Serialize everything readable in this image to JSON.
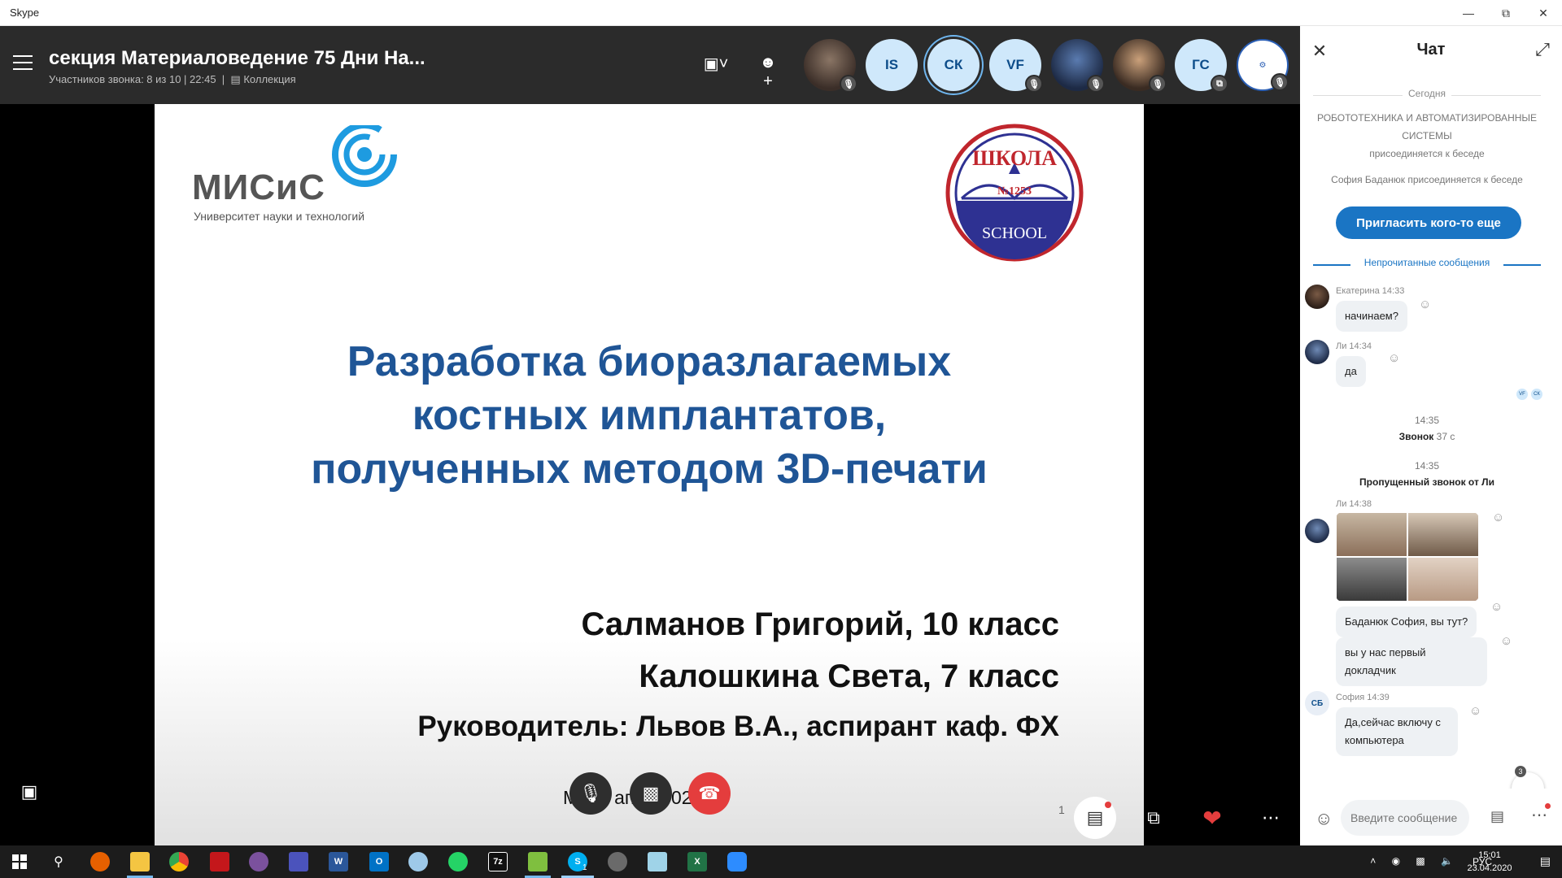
{
  "window": {
    "app_title": "Skype"
  },
  "call": {
    "title": "секция Материаловедение 75 Дни На...",
    "subtitle": "Участников звонка: 8 из 10 | 22:45",
    "collection_label": "Коллекция",
    "participants": [
      {
        "initials": "",
        "kind": "photo1",
        "muted": true
      },
      {
        "initials": "IS",
        "kind": "initials",
        "muted": false
      },
      {
        "initials": "СК",
        "kind": "initials-active",
        "muted": false
      },
      {
        "initials": "VF",
        "kind": "initials",
        "muted": true
      },
      {
        "initials": "",
        "kind": "photo2",
        "muted": true
      },
      {
        "initials": "",
        "kind": "photo3",
        "muted": true
      },
      {
        "initials": "ГС",
        "kind": "initials",
        "muted": false
      },
      {
        "initials": "",
        "kind": "robot",
        "muted": true
      }
    ]
  },
  "slide": {
    "logo_text": "МИСиС",
    "logo_sub": "Университет науки и технологий",
    "school_logo_top": "ШКОЛА",
    "school_logo_num": "№1253",
    "school_logo_bottom": "SCHOOL",
    "title_line1": "Разработка биоразлагаемых",
    "title_line2": "костных имплантатов,",
    "title_line3": "полученных методом 3D-печати",
    "author1": "Салманов Григорий, 10 класс",
    "author2": "Калошкина Света, 7 класс",
    "author3": "Руководитель: Львов В.А., аспирант каф. ФХ",
    "city_date": "М  ва, апрел  020",
    "page_number": "1"
  },
  "chat": {
    "title": "Чат",
    "day_label": "Сегодня",
    "sys_msg1": "РОБОТОТЕХНИКА И АВТОМАТИЗИРОВАННЫЕ СИСТЕМЫ",
    "sys_msg1b": "присоединяется к беседе",
    "sys_msg2": "София Баданюк присоединяется к беседе",
    "invite_button": "Пригласить кого-то еще",
    "unread_label": "Непрочитанные сообщения",
    "messages": [
      {
        "author_time": "Екатерина 14:33",
        "text": "начинаем?"
      },
      {
        "author_time": "Ли 14:34",
        "text": "да"
      },
      {
        "author_time": "Ли 14:38",
        "text": "Баданюк София, вы тут?"
      },
      {
        "author_time": "",
        "text": "вы у нас первый докладчик"
      },
      {
        "author_time": "София 14:39",
        "text": "Да,сейчас включу с компьютера"
      }
    ],
    "read_receipts": [
      "VF",
      "СК"
    ],
    "event1_time": "14:35",
    "event1_label": "Звонок",
    "event1_duration": "37 с",
    "event2_time": "14:35",
    "event2_label": "Пропущенный звонок от Ли",
    "sofia_initials": "СБ",
    "unread_count": "3",
    "composer_placeholder": "Введите сообщение"
  },
  "taskbar": {
    "language": "РУС",
    "time": "15:01",
    "date": "23.04.2020",
    "skype_badge": "1",
    "apps": [
      "firefox",
      "explorer",
      "chrome",
      "acrobat",
      "viber",
      "teams",
      "word",
      "outlook",
      "paint",
      "whatsapp",
      "7zip",
      "notepad",
      "skype",
      "security",
      "glass",
      "excel",
      "zoom"
    ]
  },
  "colors": {
    "header_bg": "#2b2b2b",
    "slide_title": "#1f5596",
    "accent": "#1a75c4",
    "end_call": "#e43d3d"
  }
}
